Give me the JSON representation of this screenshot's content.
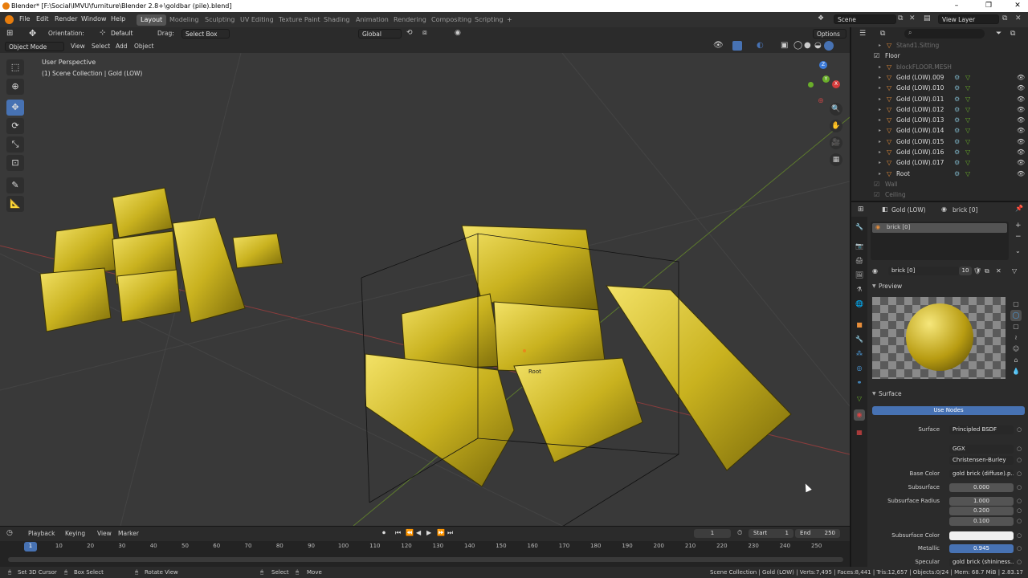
{
  "window": {
    "title": "Blender* [F:\\Social\\IMVU\\furniture\\Blender 2.8+\\goldbar (pile).blend]",
    "minimize": "–",
    "maximize": "❐",
    "close": "✕"
  },
  "menu": [
    "File",
    "Edit",
    "Render",
    "Window",
    "Help"
  ],
  "workspaces": [
    "Layout",
    "Modeling",
    "Sculpting",
    "UV Editing",
    "Texture Paint",
    "Shading",
    "Animation",
    "Rendering",
    "Compositing",
    "Scripting",
    "+"
  ],
  "active_workspace": "Layout",
  "scene": {
    "name": "Scene",
    "view_layer": "View Layer"
  },
  "toolbar": {
    "orientation_label": "Orientation:",
    "orientation_value": "Default",
    "drag_label": "Drag:",
    "drag_value": "Select Box",
    "transform_orientation": "Global",
    "options": "Options"
  },
  "viewport_header": {
    "mode": "Object Mode",
    "menus": [
      "View",
      "Select",
      "Add",
      "Object"
    ]
  },
  "viewport": {
    "perspective": "User Perspective",
    "collection": "(1) Scene Collection | Gold (LOW)",
    "origin_label": "Root"
  },
  "gizmo": {
    "z": "Z",
    "y": "Y",
    "x": "X"
  },
  "outliner": {
    "rows": [
      {
        "name": "Stand1.Sitting",
        "type": "dim",
        "depth": 1
      },
      {
        "name": "Floor",
        "type": "collection",
        "depth": 0
      },
      {
        "name": "blockFLOOR.MESH",
        "type": "dim",
        "depth": 1
      },
      {
        "name": "Gold (LOW).009",
        "type": "mesh",
        "depth": 1
      },
      {
        "name": "Gold (LOW).010",
        "type": "mesh",
        "depth": 1
      },
      {
        "name": "Gold (LOW).011",
        "type": "mesh",
        "depth": 1
      },
      {
        "name": "Gold (LOW).012",
        "type": "mesh",
        "depth": 1
      },
      {
        "name": "Gold (LOW).013",
        "type": "mesh",
        "depth": 1
      },
      {
        "name": "Gold (LOW).014",
        "type": "mesh",
        "depth": 1
      },
      {
        "name": "Gold (LOW).015",
        "type": "mesh",
        "depth": 1
      },
      {
        "name": "Gold (LOW).016",
        "type": "mesh",
        "depth": 1
      },
      {
        "name": "Gold (LOW).017",
        "type": "mesh",
        "depth": 1
      },
      {
        "name": "Root",
        "type": "mesh",
        "depth": 1
      },
      {
        "name": "Wall",
        "type": "dimcol",
        "depth": 0
      },
      {
        "name": "Ceiling",
        "type": "dimcol",
        "depth": 0
      }
    ]
  },
  "properties": {
    "object": "Gold (LOW)",
    "material": "brick [0]",
    "slot": "brick [0]",
    "material_field": "brick [0]",
    "users": "10",
    "preview_label": "Preview",
    "surface_panel": "Surface",
    "use_nodes": "Use Nodes",
    "fields": [
      {
        "label": "Surface",
        "value": "Principled BSDF",
        "kind": "dark"
      },
      {
        "label": "",
        "value": "GGX",
        "kind": "dark"
      },
      {
        "label": "",
        "value": "Christensen-Burley",
        "kind": "dark"
      },
      {
        "label": "Base Color",
        "value": "gold brick (diffuse).p...",
        "kind": "dark"
      },
      {
        "label": "Subsurface",
        "value": "0.000",
        "kind": "num"
      },
      {
        "label": "Subsurface Radius",
        "value": "1.000",
        "kind": "num"
      },
      {
        "label": "",
        "value": "0.200",
        "kind": "num"
      },
      {
        "label": "",
        "value": "0.100",
        "kind": "num"
      },
      {
        "label": "Subsurface Color",
        "value": "",
        "kind": "white"
      },
      {
        "label": "Metallic",
        "value": "0.945",
        "kind": "blue"
      },
      {
        "label": "Specular",
        "value": "gold brick (shininess...",
        "kind": "dark"
      }
    ]
  },
  "timeline": {
    "menus": [
      "Playback",
      "Keying",
      "View",
      "Marker"
    ],
    "current_frame": "1",
    "start_label": "Start",
    "start": "1",
    "end_label": "End",
    "end": "250",
    "ticks": [
      "1",
      "10",
      "20",
      "30",
      "40",
      "50",
      "60",
      "70",
      "80",
      "90",
      "100",
      "110",
      "120",
      "130",
      "140",
      "150",
      "160",
      "170",
      "180",
      "190",
      "200",
      "210",
      "220",
      "230",
      "240",
      "250"
    ]
  },
  "status": {
    "left": [
      "Set 3D Cursor",
      "Box Select",
      "Rotate View",
      "Select",
      "Move"
    ],
    "right": "Scene Collection | Gold (LOW) | Verts:7,495 | Faces:8,441 | Tris:12,657 | Objects:0/24 | Mem: 68.7 MiB | 2.83.17"
  },
  "colors": {
    "accent": "#4772b3",
    "gold": "#c9b21f",
    "viewport_bg": "#393939"
  }
}
